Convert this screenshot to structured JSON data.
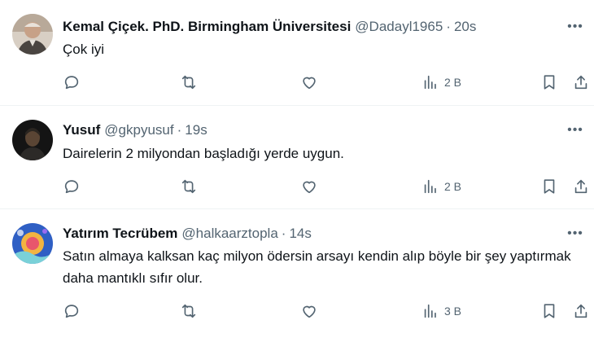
{
  "tweets": [
    {
      "author": "Kemal Çiçek. PhD. Birmingham Üniversitesi",
      "handle": "@Dadayl1965",
      "separator": "·",
      "time": "20s",
      "text": "Çok iyi",
      "views": "2 B",
      "avatar_icon": "elderly-man-avatar",
      "avatar_colors": [
        "#c9b8a6",
        "#5c5148"
      ]
    },
    {
      "author": "Yusuf",
      "handle": "@gkpyusuf",
      "separator": "·",
      "time": "19s",
      "text": "Dairelerin 2 milyondan başladığı yerde uygun.",
      "views": "2 B",
      "avatar_icon": "dark-portrait-avatar",
      "avatar_colors": [
        "#1a1a1a",
        "#6b5440"
      ]
    },
    {
      "author": "Yatırım Tecrübem",
      "handle": "@halkaarztopla",
      "separator": "·",
      "time": "14s",
      "text": "Satın almaya kalksan kaç milyon ödersin arsayı kendin alıp böyle bir şey yaptırmak daha mantıklı sıfır olur.",
      "views": "3 B",
      "avatar_icon": "colorful-illustration-avatar",
      "avatar_colors": [
        "#3b6fd1",
        "#f2b441",
        "#e8566c"
      ]
    }
  ],
  "colors": {
    "text_primary": "#0f1419",
    "text_secondary": "#536471",
    "divider": "#eff3f4"
  },
  "icons": [
    "reply-icon",
    "retweet-icon",
    "like-icon",
    "views-icon",
    "bookmark-icon",
    "share-icon",
    "more-icon"
  ]
}
